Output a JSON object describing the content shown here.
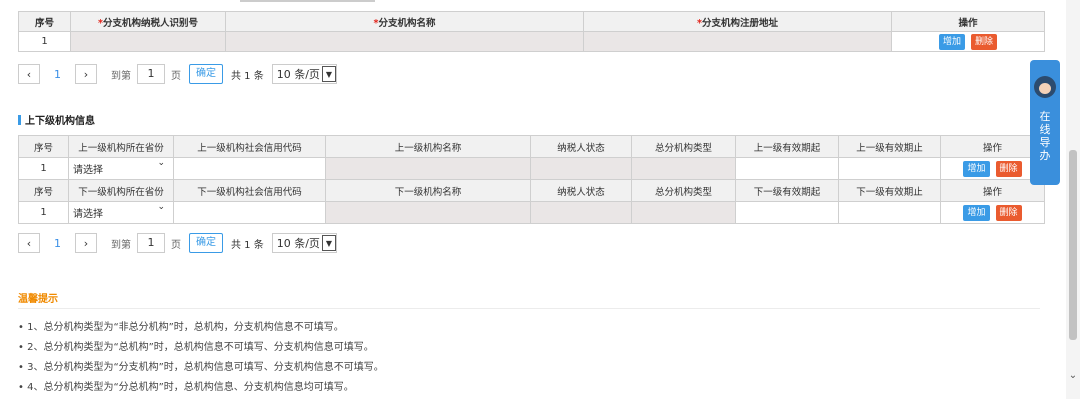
{
  "branch_table": {
    "headers": [
      "序号",
      "*分支机构纳税人识别号",
      "*分支机构名称",
      "*分支机构注册地址",
      "操作"
    ],
    "rows": [
      {
        "index": "1"
      }
    ]
  },
  "actions": {
    "add": "增加",
    "delete": "删除"
  },
  "pager": {
    "current_page": "1",
    "goto_label": "到第",
    "goto_value": "1",
    "page_unit": "页",
    "confirm": "确定",
    "total": "共 1 条",
    "page_size": "10 条/页"
  },
  "superior_section": {
    "title": "上下级机构信息"
  },
  "superior_table": {
    "headers": [
      "序号",
      "上一级机构所在省份",
      "上一级机构社会信用代码",
      "上一级机构名称",
      "纳税人状态",
      "总分机构类型",
      "上一级有效期起",
      "上一级有效期止",
      "操作"
    ],
    "row": {
      "index": "1",
      "province": "请选择"
    }
  },
  "subordinate_table": {
    "headers": [
      "序号",
      "下一级机构所在省份",
      "下一级机构社会信用代码",
      "下一级机构名称",
      "纳税人状态",
      "总分机构类型",
      "下一级有效期起",
      "下一级有效期止",
      "操作"
    ],
    "row": {
      "index": "1",
      "province": "请选择"
    }
  },
  "tips": {
    "title": "温馨提示",
    "items": [
      "• 1、总分机构类型为“非总分机构”时，总机构，分支机构信息不可填写。",
      "• 2、总分机构类型为“总机构”时，总机构信息不可填写、分支机构信息可填写。",
      "• 3、总分机构类型为“分支机构”时，总机构信息可填写、分支机构信息不可填写。",
      "• 4、总分机构类型为“分总机构”时，总机构信息、分支机构信息均可填写。"
    ]
  },
  "online_guide": {
    "label": "在线导办",
    "chars": [
      "在",
      "线",
      "导",
      "办"
    ]
  },
  "icons": [
    "chevron-left-icon",
    "chevron-right-icon",
    "chevron-down-icon",
    "customer-service-avatar-icon"
  ],
  "colors": {
    "accent_blue": "#3a9be6",
    "delete_red": "#ea5b2f",
    "required_red": "#e2231a",
    "tips_orange": "#f08a00",
    "guide_blue": "#3a8fdc"
  }
}
